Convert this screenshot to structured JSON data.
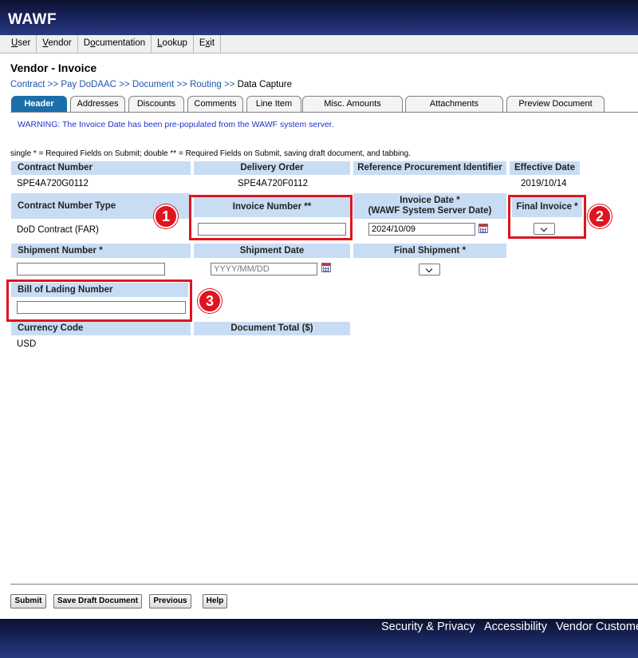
{
  "app": {
    "logo": "WAWF"
  },
  "menu": [
    {
      "pre": "",
      "ul": "U",
      "post": "ser"
    },
    {
      "pre": "",
      "ul": "V",
      "post": "endor"
    },
    {
      "pre": "D",
      "ul": "o",
      "post": "cumentation"
    },
    {
      "pre": "",
      "ul": "L",
      "post": "ookup"
    },
    {
      "pre": "E",
      "ul": "x",
      "post": "it"
    }
  ],
  "page": {
    "title": "Vendor - Invoice"
  },
  "breadcrumb": {
    "sep": ">>",
    "items": [
      "Contract",
      "Pay DoDAAC",
      "Document",
      "Routing"
    ],
    "current": "Data Capture"
  },
  "tabs": [
    "Header",
    "Addresses",
    "Discounts",
    "Comments",
    "Line Item",
    "Misc. Amounts",
    "Attachments",
    "Preview Document"
  ],
  "warning": "WARNING: The Invoice Date has been pre-populated from the WAWF system server.",
  "required_note": "single * = Required Fields on Submit; double ** = Required Fields on Submit, saving draft document, and tabbing.",
  "fields": {
    "contract_number": {
      "label": "Contract Number",
      "value": "SPE4A720G0112"
    },
    "delivery_order": {
      "label": "Delivery Order",
      "value": "SPE4A720F0112"
    },
    "ref_procurement": {
      "label": "Reference Procurement Identifier",
      "value": ""
    },
    "effective_date": {
      "label": "Effective Date",
      "value": "2019/10/14"
    },
    "contract_number_type": {
      "label": "Contract Number Type",
      "value": "DoD Contract (FAR)"
    },
    "invoice_number": {
      "label": "Invoice Number **",
      "value": ""
    },
    "invoice_date": {
      "label_line1": "Invoice Date *",
      "label_line2": "(WAWF System Server Date)",
      "value": "2024/10/09"
    },
    "final_invoice": {
      "label": "Final Invoice *",
      "value": ""
    },
    "shipment_number": {
      "label": "Shipment Number *",
      "value": ""
    },
    "shipment_date": {
      "label": "Shipment Date",
      "placeholder": "YYYY/MM/DD"
    },
    "final_shipment": {
      "label": "Final Shipment *",
      "value": ""
    },
    "bill_of_lading": {
      "label": "Bill of Lading Number",
      "value": ""
    },
    "currency_code": {
      "label": "Currency Code",
      "value": "USD"
    },
    "document_total": {
      "label": "Document Total ($)",
      "value": ""
    }
  },
  "callouts": [
    "1",
    "2",
    "3"
  ],
  "buttons": {
    "submit": "Submit",
    "save_draft": "Save Draft Document",
    "previous": "Previous",
    "help": "Help"
  },
  "footer": {
    "links": [
      "Security & Privacy",
      "Accessibility",
      "Vendor Custome"
    ]
  },
  "colors": {
    "header_bg": "#c8dcf4",
    "tab_active": "#1c6ea8",
    "highlight": "#e0141e",
    "link": "#1f56a8",
    "warning": "#1f34c8",
    "banner": "#1a2660"
  }
}
